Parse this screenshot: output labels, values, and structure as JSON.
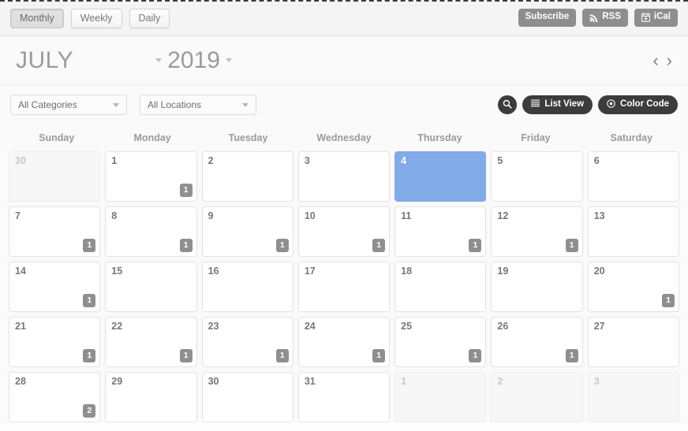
{
  "toolbar": {
    "views": [
      {
        "label": "Monthly",
        "active": true
      },
      {
        "label": "Weekly",
        "active": false
      },
      {
        "label": "Daily",
        "active": false
      }
    ],
    "actions": [
      {
        "label": "Subscribe",
        "icon": "none"
      },
      {
        "label": "RSS",
        "icon": "rss-icon"
      },
      {
        "label": "iCal",
        "icon": "calendar-icon"
      }
    ]
  },
  "header": {
    "month": "JULY",
    "year": "2019",
    "prev_label": "‹",
    "next_label": "›"
  },
  "filters": {
    "category": {
      "value": "All Categories"
    },
    "location": {
      "value": "All Locations"
    },
    "buttons": [
      {
        "label": "List View",
        "icon": "list-icon"
      },
      {
        "label": "Color Code",
        "icon": "target-icon"
      }
    ],
    "search_icon": "search-icon"
  },
  "calendar": {
    "weekdays": [
      "Sunday",
      "Monday",
      "Tuesday",
      "Wednesday",
      "Thursday",
      "Friday",
      "Saturday"
    ],
    "accent_color": "#82aae6",
    "badge_color": "#8f8f8f",
    "weeks": [
      [
        {
          "day": "30",
          "muted": true,
          "today": false,
          "events": null
        },
        {
          "day": "1",
          "muted": false,
          "today": false,
          "events": "1"
        },
        {
          "day": "2",
          "muted": false,
          "today": false,
          "events": null
        },
        {
          "day": "3",
          "muted": false,
          "today": false,
          "events": null
        },
        {
          "day": "4",
          "muted": false,
          "today": true,
          "events": null
        },
        {
          "day": "5",
          "muted": false,
          "today": false,
          "events": null
        },
        {
          "day": "6",
          "muted": false,
          "today": false,
          "events": null
        }
      ],
      [
        {
          "day": "7",
          "muted": false,
          "today": false,
          "events": "1"
        },
        {
          "day": "8",
          "muted": false,
          "today": false,
          "events": "1"
        },
        {
          "day": "9",
          "muted": false,
          "today": false,
          "events": "1"
        },
        {
          "day": "10",
          "muted": false,
          "today": false,
          "events": "1"
        },
        {
          "day": "11",
          "muted": false,
          "today": false,
          "events": "1"
        },
        {
          "day": "12",
          "muted": false,
          "today": false,
          "events": "1"
        },
        {
          "day": "13",
          "muted": false,
          "today": false,
          "events": null
        }
      ],
      [
        {
          "day": "14",
          "muted": false,
          "today": false,
          "events": "1"
        },
        {
          "day": "15",
          "muted": false,
          "today": false,
          "events": null
        },
        {
          "day": "16",
          "muted": false,
          "today": false,
          "events": null
        },
        {
          "day": "17",
          "muted": false,
          "today": false,
          "events": null
        },
        {
          "day": "18",
          "muted": false,
          "today": false,
          "events": null
        },
        {
          "day": "19",
          "muted": false,
          "today": false,
          "events": null
        },
        {
          "day": "20",
          "muted": false,
          "today": false,
          "events": "1"
        }
      ],
      [
        {
          "day": "21",
          "muted": false,
          "today": false,
          "events": "1"
        },
        {
          "day": "22",
          "muted": false,
          "today": false,
          "events": "1"
        },
        {
          "day": "23",
          "muted": false,
          "today": false,
          "events": "1"
        },
        {
          "day": "24",
          "muted": false,
          "today": false,
          "events": "1"
        },
        {
          "day": "25",
          "muted": false,
          "today": false,
          "events": "1"
        },
        {
          "day": "26",
          "muted": false,
          "today": false,
          "events": "1"
        },
        {
          "day": "27",
          "muted": false,
          "today": false,
          "events": null
        }
      ],
      [
        {
          "day": "28",
          "muted": false,
          "today": false,
          "events": "2"
        },
        {
          "day": "29",
          "muted": false,
          "today": false,
          "events": null
        },
        {
          "day": "30",
          "muted": false,
          "today": false,
          "events": null
        },
        {
          "day": "31",
          "muted": false,
          "today": false,
          "events": null
        },
        {
          "day": "1",
          "muted": true,
          "today": false,
          "events": null
        },
        {
          "day": "2",
          "muted": true,
          "today": false,
          "events": null
        },
        {
          "day": "3",
          "muted": true,
          "today": false,
          "events": null
        }
      ]
    ]
  }
}
